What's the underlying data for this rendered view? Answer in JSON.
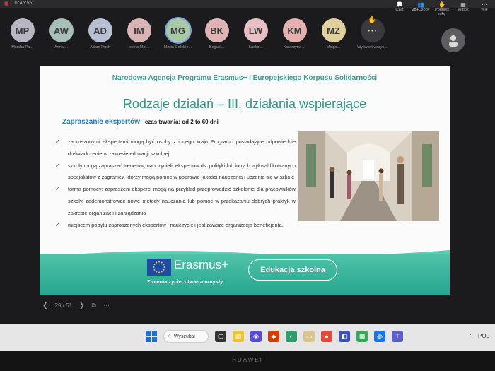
{
  "topbar": {
    "time": "01:45:55",
    "actions": [
      {
        "label": "Czat",
        "glyph": "💬",
        "count": ""
      },
      {
        "label": "Osoby",
        "glyph": "👥",
        "count": "284"
      },
      {
        "label": "Podnieś rękę",
        "glyph": "✋",
        "count": ""
      },
      {
        "label": "Widok",
        "glyph": "▦",
        "count": ""
      },
      {
        "label": "Wię",
        "glyph": "⋯",
        "count": ""
      }
    ]
  },
  "participants": [
    {
      "initials": "MP",
      "name": "Monika Pa...",
      "color": "#b8b6c2",
      "active": false
    },
    {
      "initials": "AW",
      "name": "Anna ...",
      "color": "#a8bfb8",
      "active": false
    },
    {
      "initials": "AD",
      "name": "Adam Duch",
      "color": "#b7bfd2",
      "active": false
    },
    {
      "initials": "IM",
      "name": "Iwona Mor...",
      "color": "#d8b4b4",
      "active": false
    },
    {
      "initials": "MG",
      "name": "Marta Gołębie...",
      "color": "#a7c9a7",
      "active": true
    },
    {
      "initials": "BK",
      "name": "Bogusł...",
      "color": "#e0b4b6",
      "active": false
    },
    {
      "initials": "LW",
      "name": "Lasko...",
      "color": "#e8c0c4",
      "active": false
    },
    {
      "initials": "KM",
      "name": "Katarzyna ...",
      "color": "#e3b2ae",
      "active": false
    },
    {
      "initials": "MZ",
      "name": "Małgo...",
      "color": "#dfd09e",
      "active": false
    }
  ],
  "more_participants": {
    "glyph": "⋯",
    "label": "Wyświetl wszys..."
  },
  "slide": {
    "header": "Narodowa Agencja Programu Erasmus+ i Europejskiego Korpusu Solidarności",
    "title": "Rodzaje działań – III. działania wspierające",
    "section_label": "Zapraszanie ekspertów",
    "section_duration": "czas trwania: od 2 to 60 dni",
    "bullets": [
      "zaproszonymi ekspertami mogą być osoby z innego kraju Programu posiadające odpowiednie doświadczenie w zakresie edukacji szkolnej",
      "szkoły mogą zapraszać trenerów, nauczycieli, ekspertów ds. polityki lub innych wykwalifikowanych specjalistów z zagranicy, którzy mogą pomóc w poprawie jakości nauczania i uczenia się w szkole",
      "forma pomocy: zaproszeni eksperci mogą na przykład przeprowadzić szkolenie dla pracowników szkoły, zademonstrować nowe metody nauczania lub pomóc w przekazaniu dobrych praktyk w zakresie organizacji i zarządzania",
      "miejscem pobytu zaproszonych ekspertów i nauczycieli jest zawsze organizacja beneficjenta."
    ],
    "footer": {
      "brand": "Erasmus+",
      "tagline": "Zmienia życie, otwiera umysły",
      "badge": "Edukacja szkolna"
    }
  },
  "slide_nav": {
    "page": "29 / 51"
  },
  "taskbar": {
    "search_label": "Wyszukaj",
    "lang": "POL"
  },
  "device_brand": "HUAWEI"
}
